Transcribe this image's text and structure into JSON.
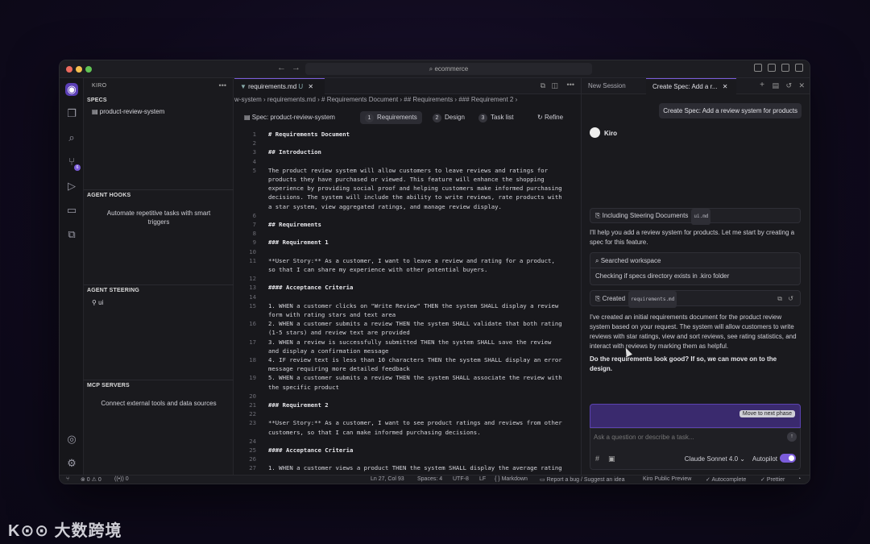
{
  "titlebar": {
    "back": "←",
    "forward": "→",
    "search_text": "ecommerce"
  },
  "sidebar": {
    "header": "KIRO",
    "specs_title": "SPECS",
    "specs_item": "product-review-system",
    "hooks_title": "AGENT HOOKS",
    "hooks_desc_1": "Automate repetitive tasks with smart",
    "hooks_desc_2": "triggers",
    "steering_title": "AGENT STEERING",
    "steering_item": "ui",
    "mcp_title": "MCP SERVERS",
    "mcp_desc": "Connect external tools and data sources"
  },
  "editor": {
    "tab_name": "requirements.md",
    "tab_status": "U",
    "breadcrumb": "w-system  ›  requirements.md  ›  # Requirements Document  ›  ## Requirements  ›  ### Requirement 2  ›",
    "spec_label": "Spec: product-review-system",
    "spec_tabs": [
      {
        "num": "1",
        "label": "Requirements"
      },
      {
        "num": "2",
        "label": "Design"
      },
      {
        "num": "3",
        "label": "Task list"
      }
    ],
    "refine": "Refine",
    "lines": [
      {
        "n": "1",
        "t": "# Requirements Document",
        "h": true
      },
      {
        "n": "2",
        "t": ""
      },
      {
        "n": "3",
        "t": "## Introduction",
        "h": true
      },
      {
        "n": "4",
        "t": ""
      },
      {
        "n": "5",
        "t": "The product review system will allow customers to leave reviews and ratings for"
      },
      {
        "n": "",
        "t": "products they have purchased or viewed. This feature will enhance the shopping"
      },
      {
        "n": "",
        "t": "experience by providing social proof and helping customers make informed purchasing"
      },
      {
        "n": "",
        "t": "decisions. The system will include the ability to write reviews, rate products with"
      },
      {
        "n": "",
        "t": "a star system, view aggregated ratings, and manage review display."
      },
      {
        "n": "6",
        "t": ""
      },
      {
        "n": "7",
        "t": "## Requirements",
        "h": true
      },
      {
        "n": "8",
        "t": ""
      },
      {
        "n": "9",
        "t": "### Requirement 1",
        "h": true
      },
      {
        "n": "10",
        "t": ""
      },
      {
        "n": "11",
        "t": "**User Story:** As a customer, I want to leave a review and rating for a product,"
      },
      {
        "n": "",
        "t": "so that I can share my experience with other potential buyers."
      },
      {
        "n": "12",
        "t": ""
      },
      {
        "n": "13",
        "t": "#### Acceptance Criteria",
        "h": true
      },
      {
        "n": "14",
        "t": ""
      },
      {
        "n": "15",
        "t": "1. WHEN a customer clicks on \"Write Review\" THEN the system SHALL display a review"
      },
      {
        "n": "",
        "t": "form with rating stars and text area"
      },
      {
        "n": "16",
        "t": "2. WHEN a customer submits a review THEN the system SHALL validate that both rating"
      },
      {
        "n": "",
        "t": "(1-5 stars) and review text are provided"
      },
      {
        "n": "17",
        "t": "3. WHEN a review is successfully submitted THEN the system SHALL save the review"
      },
      {
        "n": "",
        "t": "and display a confirmation message"
      },
      {
        "n": "18",
        "t": "4. IF review text is less than 10 characters THEN the system SHALL display an error"
      },
      {
        "n": "",
        "t": "message requiring more detailed feedback"
      },
      {
        "n": "19",
        "t": "5. WHEN a customer submits a review THEN the system SHALL associate the review with"
      },
      {
        "n": "",
        "t": "the specific product"
      },
      {
        "n": "20",
        "t": ""
      },
      {
        "n": "21",
        "t": "### Requirement 2",
        "h": true
      },
      {
        "n": "22",
        "t": ""
      },
      {
        "n": "23",
        "t": "**User Story:** As a customer, I want to see product ratings and reviews from other"
      },
      {
        "n": "",
        "t": "customers, so that I can make informed purchasing decisions."
      },
      {
        "n": "24",
        "t": ""
      },
      {
        "n": "25",
        "t": "#### Acceptance Criteria",
        "h": true
      },
      {
        "n": "26",
        "t": ""
      },
      {
        "n": "27",
        "t": "1. WHEN a customer views a product THEN the system SHALL display the average rating"
      }
    ]
  },
  "chat": {
    "tab_new": "New Session",
    "tab_active": "Create Spec: Add a r...",
    "user_message": "Create Spec: Add a review system for products",
    "agent_name": "Kiro",
    "steering_label": "Including Steering Documents",
    "steering_chip": "ui.md",
    "intro": "I'll help you add a review system for products. Let me start by creating a spec for this feature.",
    "searched_label": "Searched workspace",
    "searched_detail": "Checking if specs directory exists in .kiro folder",
    "created_label": "Created",
    "created_chip": "requirements.md",
    "summary": "I've created an initial requirements document for the product review system based on your request. The system will allow customers to write reviews with star ratings, view and sort reviews, see rating statistics, and interact with reviews by marking them as helpful.",
    "question": "Do the requirements look good? If so, we can move on to the design.",
    "next_phase": "Move to next phase",
    "input_placeholder": "Ask a question or describe a task...",
    "model": "Claude Sonnet 4.0",
    "autopilot": "Autopilot"
  },
  "statusbar": {
    "errors": "⊗ 0 ⚠ 0",
    "ports": "((•)) 0",
    "position": "Ln 27, Col 93",
    "spaces": "Spaces: 4",
    "encoding": "UTF-8",
    "eol": "LF",
    "language": "{ } Markdown",
    "report": "Report a bug / Suggest an idea",
    "preview": "Kiro Public Preview",
    "autocomplete": "Autocomplete",
    "prettier": "Prettier"
  },
  "watermark": "K⊙⊙ 大数跨境"
}
